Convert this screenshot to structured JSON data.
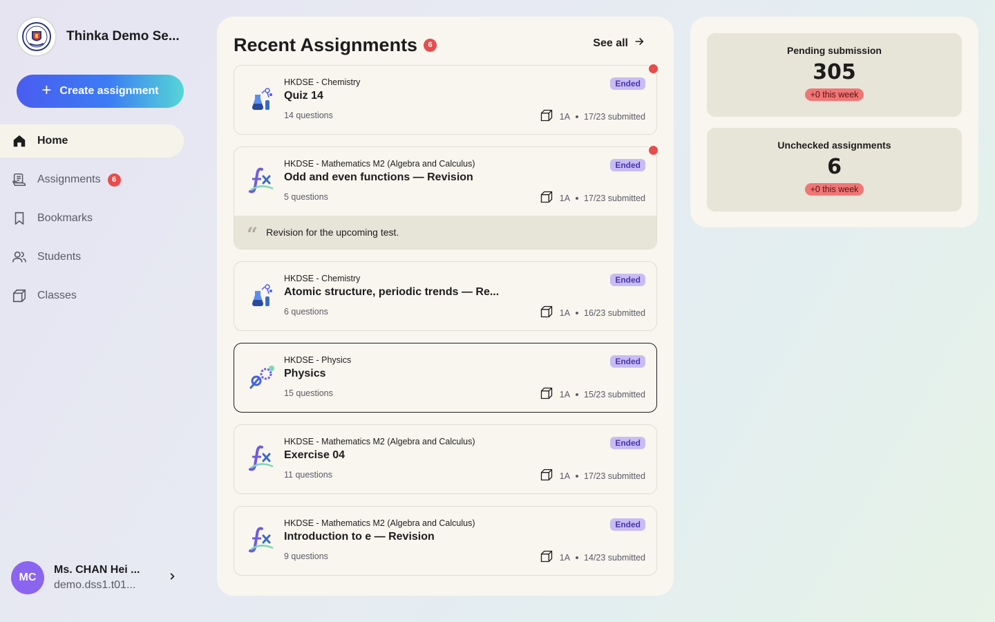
{
  "brand": {
    "name": "Thinka Demo Se..."
  },
  "sidebar": {
    "create_label": "Create assignment",
    "items": [
      {
        "label": "Home",
        "icon": "home-icon"
      },
      {
        "label": "Assignments",
        "icon": "assignments-icon",
        "badge": "6"
      },
      {
        "label": "Bookmarks",
        "icon": "bookmark-icon"
      },
      {
        "label": "Students",
        "icon": "students-icon"
      },
      {
        "label": "Classes",
        "icon": "classes-icon"
      }
    ]
  },
  "user": {
    "initials": "MC",
    "name": "Ms. CHAN Hei ...",
    "email": "demo.dss1.t01..."
  },
  "main": {
    "title": "Recent Assignments",
    "badge": "6",
    "see_all": "See all",
    "assignments": [
      {
        "subject": "HKDSE - Chemistry",
        "title": "Quiz 14",
        "questions": "14 questions",
        "status": "Ended",
        "class": "1A",
        "submitted": "17/23 submitted",
        "icon": "chemistry-icon",
        "unread": true
      },
      {
        "subject": "HKDSE - Mathematics M2 (Algebra and Calculus)",
        "title": "Odd and even functions — Revision",
        "questions": "5 questions",
        "status": "Ended",
        "class": "1A",
        "submitted": "17/23 submitted",
        "icon": "math-function-icon",
        "unread": true,
        "note": "Revision for the upcoming test."
      },
      {
        "subject": "HKDSE - Chemistry",
        "title": "Atomic structure, periodic trends — Re...",
        "questions": "6 questions",
        "status": "Ended",
        "class": "1A",
        "submitted": "16/23 submitted",
        "icon": "chemistry-icon"
      },
      {
        "subject": "HKDSE - Physics",
        "title": "Physics",
        "questions": "15 questions",
        "status": "Ended",
        "class": "1A",
        "submitted": "15/23 submitted",
        "icon": "physics-icon",
        "selected": true
      },
      {
        "subject": "HKDSE - Mathematics M2 (Algebra and Calculus)",
        "title": "Exercise 04",
        "questions": "11 questions",
        "status": "Ended",
        "class": "1A",
        "submitted": "17/23 submitted",
        "icon": "math-function-icon"
      },
      {
        "subject": "HKDSE - Mathematics M2 (Algebra and Calculus)",
        "title": "Introduction to e — Revision",
        "questions": "9 questions",
        "status": "Ended",
        "class": "1A",
        "submitted": "14/23 submitted",
        "icon": "math-function-icon"
      }
    ]
  },
  "stats": {
    "pending": {
      "label": "Pending submission",
      "value": "305",
      "delta": "+0 this week"
    },
    "unchecked": {
      "label": "Unchecked assignments",
      "value": "6",
      "delta": "+0 this week"
    }
  },
  "colors": {
    "accent": "#4a5cf0",
    "badge": "#e84c4c",
    "status_bg": "#c8bcf4",
    "avatar": "#8b65f0"
  }
}
